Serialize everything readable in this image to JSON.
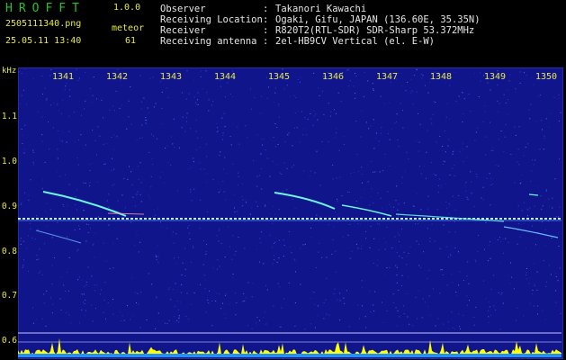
{
  "header": {
    "app_title": "HROFFT",
    "version": "1.0.0",
    "filename": "2505111340.png",
    "datetime": "25.05.11 13:40",
    "meteor_label": "meteor",
    "meteor_count": "61",
    "info": [
      {
        "label": "Observer",
        "value": "Takanori Kawachi"
      },
      {
        "label": "Receiving Location",
        "value": "Ogaki, Gifu, JAPAN (136.60E, 35.35N)"
      },
      {
        "label": "Receiver",
        "value": "R820T2(RTL-SDR) SDR-Sharp 53.372MHz"
      },
      {
        "label": "Receiving antenna",
        "value": "2el-HB9CV Vertical (el. E-W)"
      }
    ],
    "separator": ":"
  },
  "spectrogram": {
    "freq_unit": "kHz",
    "freq_ticks": [
      "1.1",
      "1.0",
      "0.9",
      "0.8",
      "0.7",
      "0.6"
    ],
    "time_ticks": [
      "1341",
      "1342",
      "1343",
      "1344",
      "1345",
      "1346",
      "1347",
      "1348",
      "1349",
      "1350"
    ],
    "colors": {
      "background": "#10158c",
      "carrier": "#c8f0ff",
      "trail": "#6cf5e0",
      "level_bar": "#ffff00",
      "grid": "#c8c8ff"
    }
  }
}
